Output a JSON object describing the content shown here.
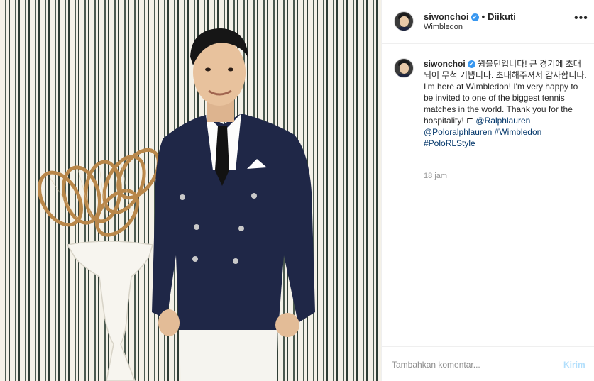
{
  "post": {
    "username": "siwonchoi",
    "verified_mark": "✔",
    "separator": "•",
    "follow_status": "Diikuti",
    "location": "Wimbledon",
    "more_icon": "•••"
  },
  "caption": {
    "username": "siwonchoi",
    "text": "윔블던입니다! 큰 경기에 초대 되어 무척 기쁩니다. 초대해주셔서 감사합니다. I'm here at Wimbledon! I'm very happy to be invited to one of the biggest tennis matches in the world. Thank you for the hospitality! ⊏ ",
    "mentions": [
      "@Ralphlauren",
      "@Poloralphlauren"
    ],
    "hashtags": [
      "#Wimbledon",
      "#PoloRLStyle"
    ],
    "time": "18 jam"
  },
  "comment_box": {
    "placeholder": "Tambahkan komentar...",
    "send_label": "Kirim"
  },
  "colors": {
    "verified": "#3897f0",
    "link": "#003569",
    "send_disabled": "#b2dffc"
  }
}
